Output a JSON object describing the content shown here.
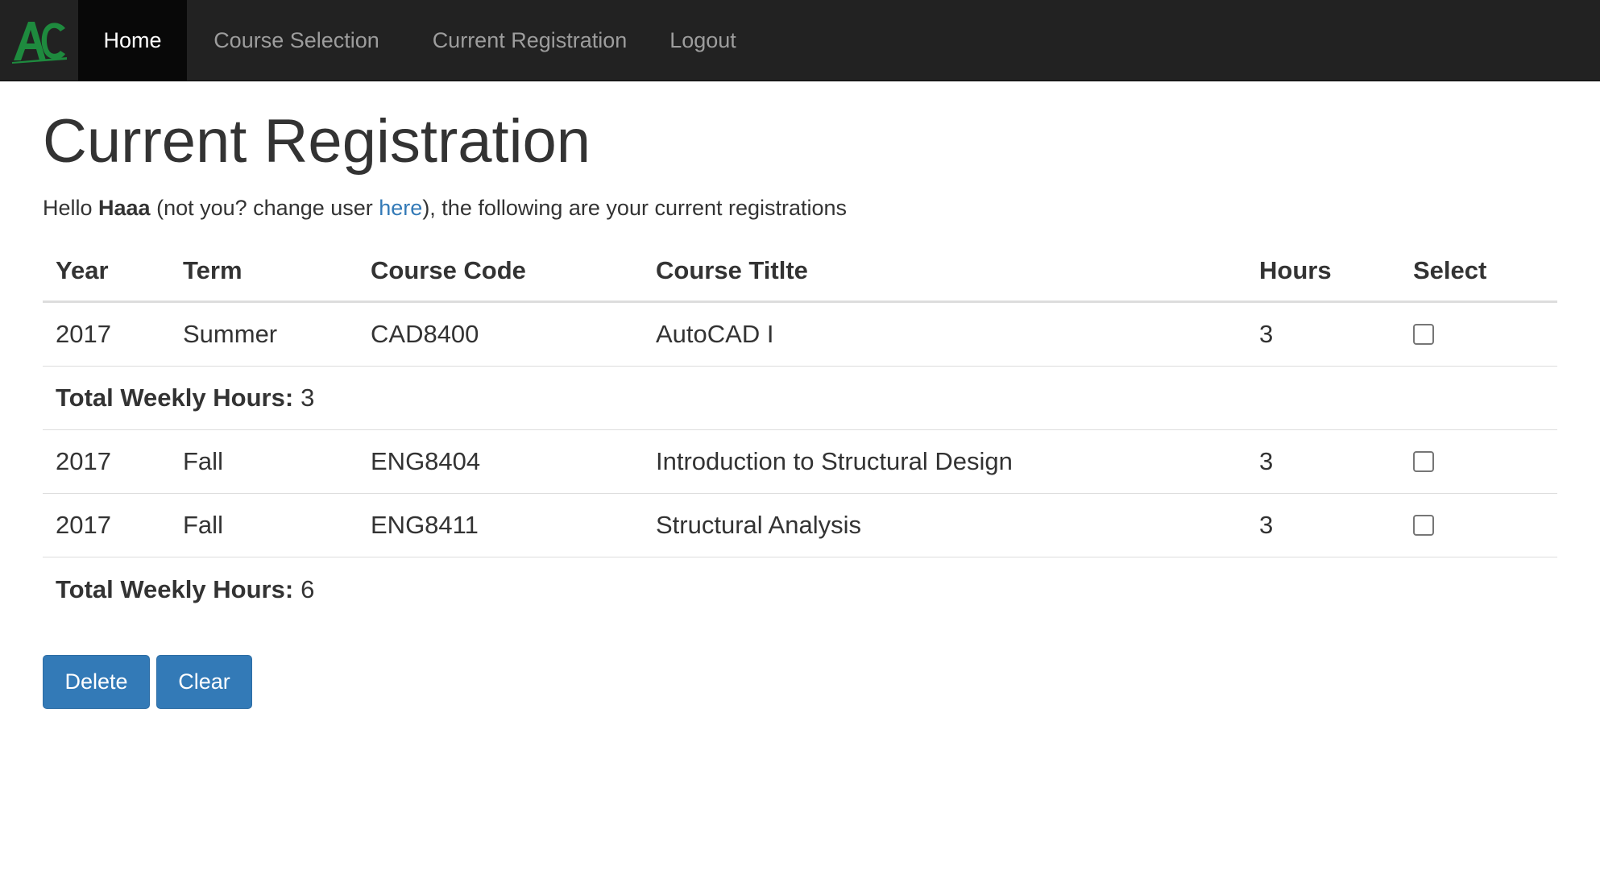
{
  "nav": {
    "logo_text": "AC",
    "items": [
      "Home",
      "Course Selection",
      "Current Registration",
      "Logout"
    ]
  },
  "page": {
    "title": "Current Registration",
    "greeting_prefix": "Hello ",
    "username": "Haaa",
    "greeting_middle": " (not you? change user ",
    "link_text": "here",
    "greeting_suffix": "), the following are your current registrations"
  },
  "table": {
    "headers": [
      "Year",
      "Term",
      "Course Code",
      "Course Titlte",
      "Hours",
      "Select"
    ],
    "groups": [
      {
        "rows": [
          {
            "year": "2017",
            "term": "Summer",
            "code": "CAD8400",
            "title": "AutoCAD I",
            "hours": "3"
          }
        ],
        "total_label": "Total Weekly Hours:",
        "total_value": "3"
      },
      {
        "rows": [
          {
            "year": "2017",
            "term": "Fall",
            "code": "ENG8404",
            "title": "Introduction to Structural Design",
            "hours": "3"
          },
          {
            "year": "2017",
            "term": "Fall",
            "code": "ENG8411",
            "title": "Structural Analysis",
            "hours": "3"
          }
        ],
        "total_label": "Total Weekly Hours:",
        "total_value": "6"
      }
    ]
  },
  "buttons": {
    "delete": "Delete",
    "clear": "Clear"
  },
  "colors": {
    "navbar": "#222222",
    "primary": "#337ab7",
    "logo": "#1e8a3e"
  }
}
